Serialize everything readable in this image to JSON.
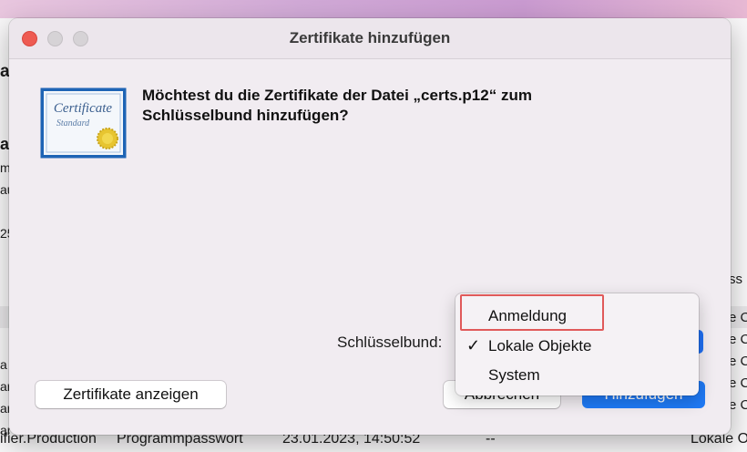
{
  "background": {
    "right_column_text": [
      "ss",
      "e C",
      "e C",
      "e C",
      "e C",
      "e C"
    ],
    "left_column_text": [
      "a",
      "ar",
      "m",
      "au",
      "25",
      "a",
      "ar",
      "ar",
      "ar"
    ],
    "bottom_row": [
      "ifier.Production",
      "Programmpasswort",
      "23.01.2023, 14:50:52",
      "--",
      "Lokale O"
    ]
  },
  "dialog": {
    "title": "Zertifikate hinzufügen",
    "icon": {
      "name": "certificate-icon",
      "text_line1": "Certificate",
      "text_line2": "Standard"
    },
    "message": "Möchtest du die Zertifikate der Datei „certs.p12“ zum Schlüsselbund hinzufügen?",
    "keychain_label": "Schlüsselbund:",
    "buttons": {
      "show_certificates": "Zertifikate anzeigen",
      "cancel": "Abbrechen",
      "add": "Hinzufügen"
    }
  },
  "menu": {
    "items": [
      {
        "label": "Anmeldung",
        "checked": false
      },
      {
        "label": "Lokale Objekte",
        "checked": true
      },
      {
        "label": "System",
        "checked": false
      }
    ],
    "check_glyph": "✓"
  },
  "colors": {
    "accent": "#1f7af6",
    "close": "#ee5b52",
    "highlight": "#e05a5a"
  }
}
